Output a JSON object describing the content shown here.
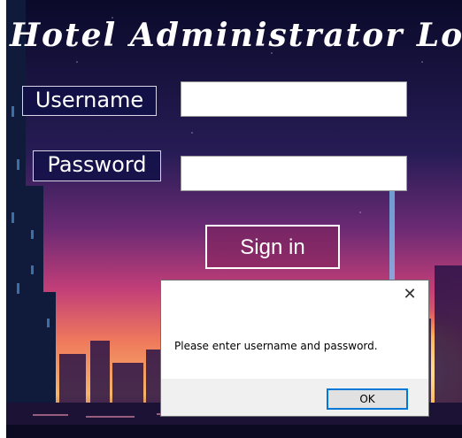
{
  "window": {
    "title": "Hotel Administrator Logi"
  },
  "form": {
    "username_label": "Username",
    "username_value": "",
    "password_label": "Password",
    "password_value": "",
    "signin_label": "Sign in"
  },
  "dialog": {
    "close_glyph": "✕",
    "message": "Please enter username and password.",
    "ok_label": "OK"
  },
  "colors": {
    "night_sky": "#0b0a2a",
    "sunset_pink": "#d8497a",
    "sunset_orange": "#f08a4a",
    "dialog_footer": "#f0f0f0",
    "ok_focus_border": "#0078d7"
  }
}
